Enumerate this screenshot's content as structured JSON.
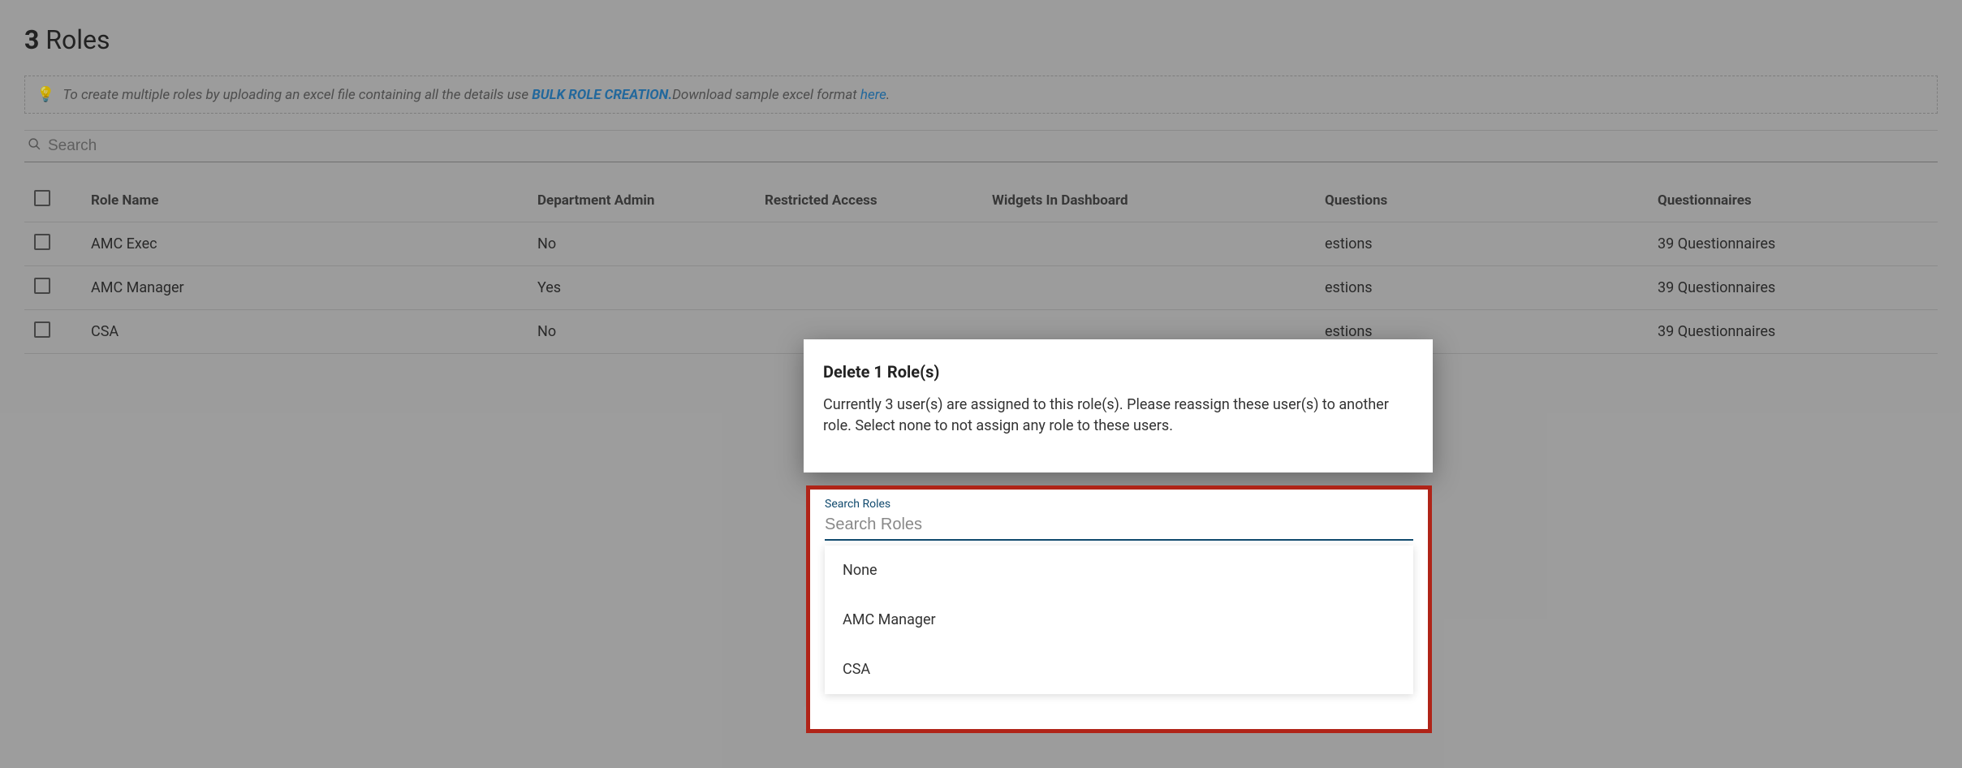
{
  "header": {
    "count": "3",
    "title_word": "Roles"
  },
  "banner": {
    "prefix": "To create multiple roles by uploading an excel file containing all the details use ",
    "bulk_link": "BULK ROLE CREATION.",
    "mid": "Download sample excel format ",
    "here_link": "here",
    "suffix": "."
  },
  "search": {
    "placeholder": "Search"
  },
  "table": {
    "columns": {
      "role_name": "Role Name",
      "dept_admin": "Department Admin",
      "restricted": "Restricted Access",
      "widgets": "Widgets In Dashboard",
      "questions": "Questions",
      "questionnaires": "Questionnaires"
    },
    "rows": [
      {
        "role_name": "AMC Exec",
        "dept_admin": "No",
        "questions": "estions",
        "questionnaires": "39 Questionnaires"
      },
      {
        "role_name": "AMC Manager",
        "dept_admin": "Yes",
        "questions": "estions",
        "questionnaires": "39 Questionnaires"
      },
      {
        "role_name": "CSA",
        "dept_admin": "No",
        "questions": "estions",
        "questionnaires": "39 Questionnaires"
      }
    ]
  },
  "dialog": {
    "title": "Delete 1 Role(s)",
    "body": "Currently 3 user(s) are assigned to this role(s). Please reassign these user(s) to another role. Select none to not assign any role to these users.",
    "search_label": "Search Roles",
    "search_placeholder": "Search Roles",
    "options": [
      "None",
      "AMC Manager",
      "CSA"
    ]
  }
}
